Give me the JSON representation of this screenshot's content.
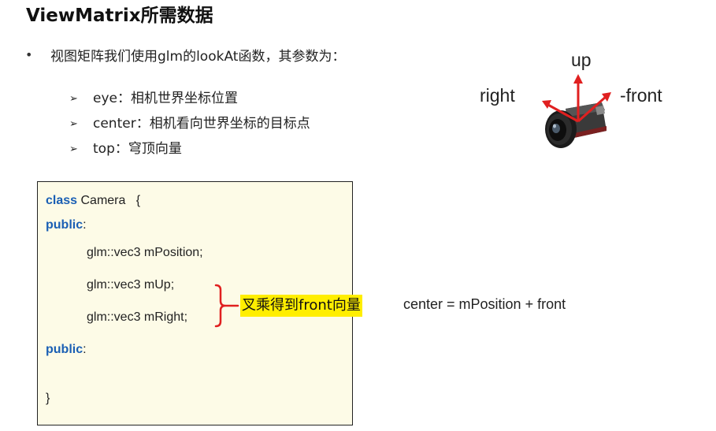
{
  "slide": {
    "title": "ViewMatrix所需数据",
    "bullet": {
      "marker": "•",
      "text": "视图矩阵我们使用glm的lookAt函数，其参数为："
    },
    "sub_items": [
      {
        "marker": "➢",
        "text": "eye：相机世界坐标位置"
      },
      {
        "marker": "➢",
        "text": "center：相机看向世界坐标的目标点"
      },
      {
        "marker": "➢",
        "text": "top：穹顶向量"
      }
    ]
  },
  "code": {
    "line1_kw": "class",
    "line1_rest": " Camera   {",
    "line2_kw": "public",
    "line2_rest": ":",
    "line3": "glm::vec3 mPosition;",
    "line4": "glm::vec3 mUp;",
    "line5": "glm::vec3 mRight;",
    "line6_kw": "public",
    "line6_rest": ":",
    "line7": "}"
  },
  "annotation": {
    "label": "叉乘得到front向量",
    "highlight_color": "#ffee00",
    "bracket_color": "#e02020"
  },
  "formula": "center = mPosition + front",
  "camera_figure": {
    "up_label": "up",
    "right_label": "right",
    "front_label": "-front",
    "arrow_color": "#e02020"
  },
  "colors": {
    "keyword": "#1a5fb4",
    "code_bg": "#fdfbe7"
  }
}
